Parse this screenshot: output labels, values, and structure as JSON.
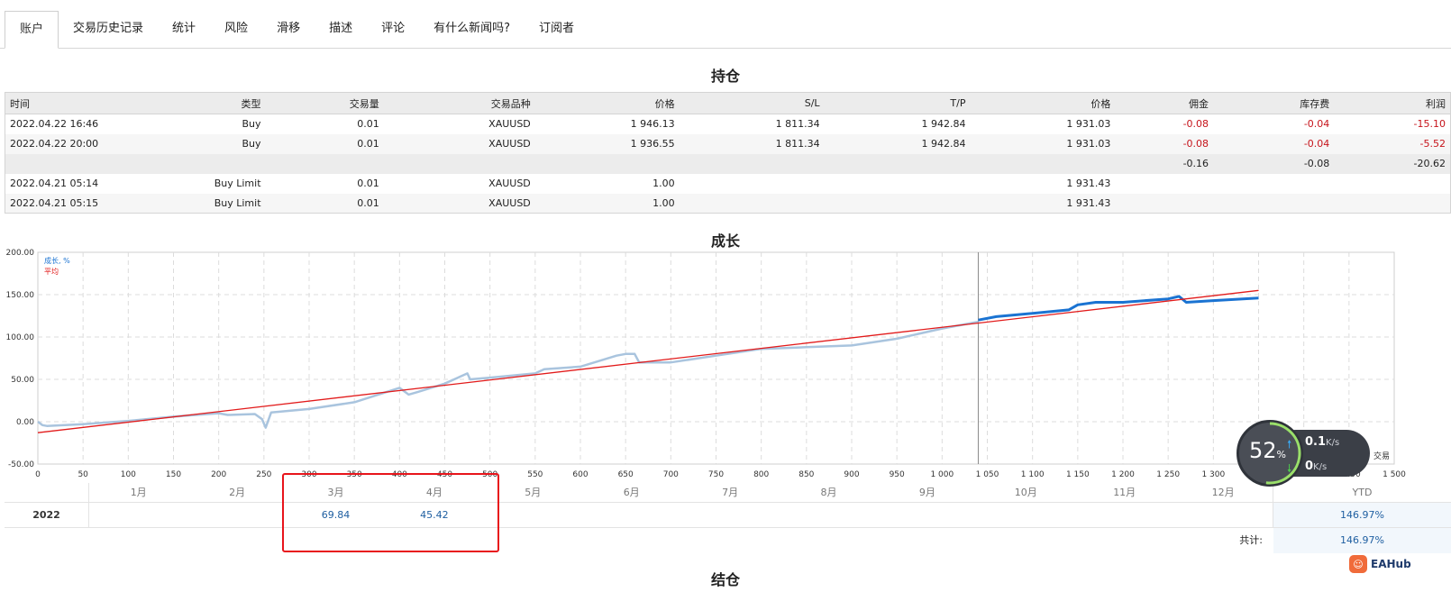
{
  "tabs": [
    {
      "label": "账户",
      "active": true
    },
    {
      "label": "交易历史记录"
    },
    {
      "label": "统计"
    },
    {
      "label": "风险"
    },
    {
      "label": "滑移"
    },
    {
      "label": "描述"
    },
    {
      "label": "评论"
    },
    {
      "label": "有什么新闻吗?"
    },
    {
      "label": "订阅者"
    }
  ],
  "positions": {
    "title": "持仓",
    "headers": [
      "时间",
      "类型",
      "交易量",
      "交易品种",
      "价格",
      "S/L",
      "T/P",
      "价格",
      "佣金",
      "库存费",
      "利润"
    ],
    "rows": [
      [
        "2022.04.22 16:46",
        "Buy",
        "0.01",
        "XAUUSD",
        "1 946.13",
        "1 811.34",
        "1 942.84",
        "1 931.03",
        "-0.08",
        "-0.04",
        "-15.10"
      ],
      [
        "2022.04.22 20:00",
        "Buy",
        "0.01",
        "XAUUSD",
        "1 936.55",
        "1 811.34",
        "1 942.84",
        "1 931.03",
        "-0.08",
        "-0.04",
        "-5.52"
      ]
    ],
    "summary": [
      "-0.16",
      "-0.08",
      "-20.62"
    ],
    "orders": [
      [
        "2022.04.21 05:14",
        "Buy Limit",
        "0.01",
        "XAUUSD",
        "1.00",
        "",
        "",
        "1 931.43",
        "",
        "",
        ""
      ],
      [
        "2022.04.21 05:15",
        "Buy Limit",
        "0.01",
        "XAUUSD",
        "1.00",
        "",
        "",
        "1 931.43",
        "",
        "",
        ""
      ]
    ]
  },
  "growth": {
    "title": "成长",
    "legend": {
      "growth": "成长, %",
      "average": "平均"
    },
    "x_axis_label": "交易",
    "colors": {
      "light": "#a9c4de",
      "dark": "#1a73d2",
      "average": "#e21b1b"
    }
  },
  "chart_data": {
    "type": "line",
    "title": "成长",
    "xlabel": "交易",
    "ylabel": "",
    "xlim": [
      0,
      1500
    ],
    "ylim": [
      -50,
      200
    ],
    "x_ticks": [
      0,
      50,
      100,
      150,
      200,
      250,
      300,
      350,
      400,
      450,
      500,
      550,
      600,
      650,
      700,
      750,
      800,
      850,
      900,
      950,
      1000,
      1050,
      1100,
      1150,
      1200,
      1250,
      1300,
      1350,
      1400,
      1450,
      1500
    ],
    "x_tick_labels": [
      "0",
      "50",
      "100",
      "150",
      "200",
      "250",
      "300",
      "350",
      "400",
      "450",
      "500",
      "550",
      "600",
      "650",
      "700",
      "750",
      "800",
      "850",
      "900",
      "950",
      "1 000",
      "1 050",
      "1 100",
      "1 150",
      "1 200",
      "1 250",
      "1 300",
      "1 350",
      "1 400",
      "1 450",
      "1 500"
    ],
    "y_ticks": [
      -50,
      0,
      50,
      100,
      150,
      200
    ],
    "y_tick_labels": [
      "-50.00",
      "0.00",
      "50.00",
      "100.00",
      "150.00",
      "200.00"
    ],
    "grid": true,
    "marker_x": 1040,
    "series": [
      {
        "name": "成长, %",
        "x": [
          0,
          5,
          10,
          30,
          50,
          100,
          150,
          200,
          210,
          240,
          248,
          252,
          258,
          300,
          350,
          400,
          410,
          420,
          450,
          475,
          478,
          500,
          550,
          560,
          600,
          640,
          650,
          660,
          665,
          670,
          700,
          750,
          800,
          850,
          900,
          950,
          1000,
          1040
        ],
        "y": [
          0,
          -4,
          -5,
          -4,
          -3,
          1,
          6,
          10,
          8,
          9,
          3,
          -7,
          11,
          15,
          23,
          40,
          32,
          35,
          45,
          57,
          50,
          52,
          57,
          62,
          65,
          78,
          80,
          80,
          70,
          70,
          70,
          78,
          86,
          88,
          90,
          98,
          110,
          118
        ]
      },
      {
        "name": "成长, %",
        "x": [
          1040,
          1060,
          1100,
          1140,
          1150,
          1170,
          1200,
          1250,
          1262,
          1270,
          1300,
          1350
        ],
        "y": [
          120,
          124,
          128,
          132,
          138,
          141,
          141,
          145,
          148,
          141,
          143,
          146
        ]
      },
      {
        "name": "平均",
        "x": [
          0,
          1350
        ],
        "y": [
          -13,
          155
        ]
      }
    ]
  },
  "monthly": {
    "months": [
      "1月",
      "2月",
      "3月",
      "4月",
      "5月",
      "6月",
      "7月",
      "8月",
      "9月",
      "10月",
      "11月",
      "12月"
    ],
    "ytd_label": "YTD",
    "year": "2022",
    "values": {
      "3月": "69.84",
      "4月": "45.42"
    },
    "ytd_value": "146.97%",
    "total_label": "共计:",
    "total_value": "146.97%"
  },
  "widget": {
    "percent": "52",
    "percent_sign": "%",
    "percent_value": 52,
    "upload": "0.1",
    "upload_unit": "K/s",
    "download": "0",
    "download_unit": "K/s"
  },
  "bottom_title": "结仓",
  "watermark": "EAHub"
}
